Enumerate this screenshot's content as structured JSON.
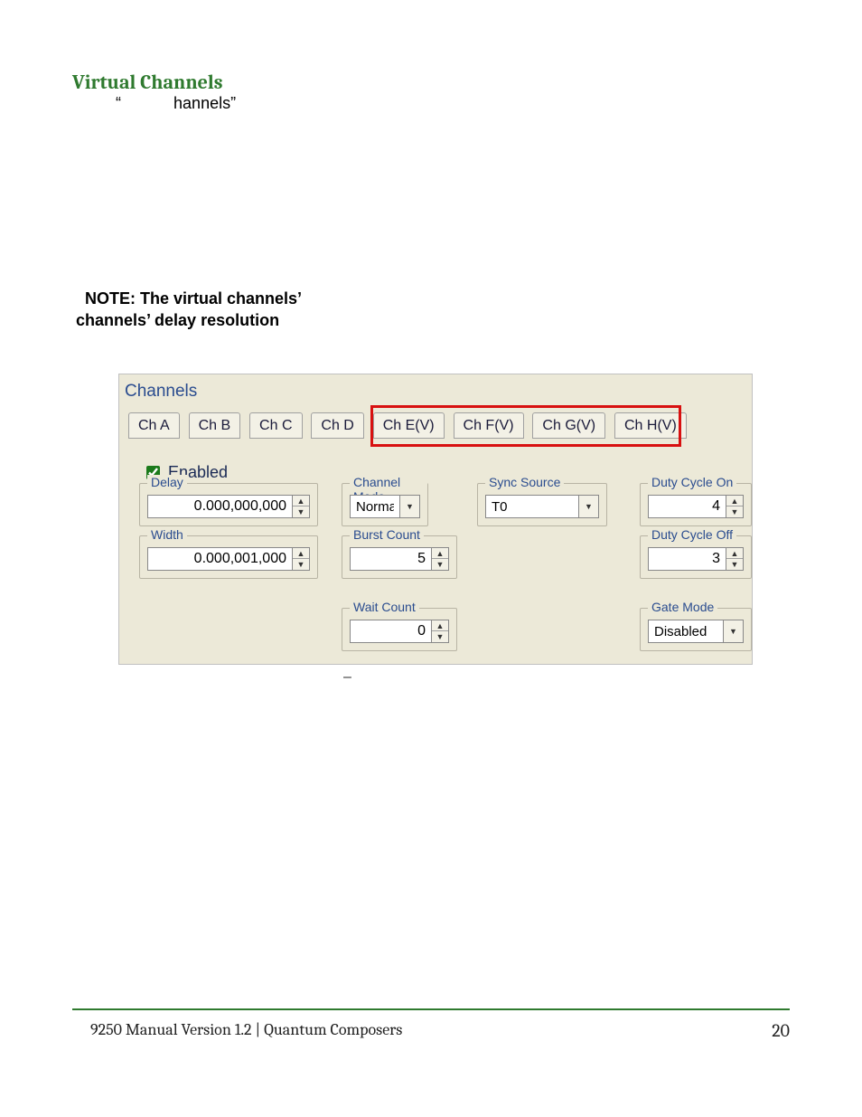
{
  "heading": "Virtual Channels",
  "subline_q1": "“",
  "subline_text": "hannels”",
  "note_line1_prefix": "NOTE: The virtual channels’",
  "note_line2": "channels’ delay resolution",
  "panel": {
    "title": "Channels",
    "tabs": [
      "Ch A",
      "Ch B",
      "Ch C",
      "Ch D",
      "Ch E(V)",
      "Ch F(V)",
      "Ch G(V)",
      "Ch H(V)"
    ],
    "enabled_label": "Enabled",
    "groups": {
      "delay": {
        "label": "Delay",
        "value": "0.000,000,000"
      },
      "width": {
        "label": "Width",
        "value": "0.000,001,000"
      },
      "chmode": {
        "label": "Channel Mode",
        "value": "Normal"
      },
      "burst": {
        "label": "Burst Count",
        "value": "5"
      },
      "wait": {
        "label": "Wait Count",
        "value": "0"
      },
      "sync": {
        "label": "Sync Source",
        "value": "T0"
      },
      "dcon": {
        "label": "Duty Cycle On",
        "value": "4"
      },
      "dcoff": {
        "label": "Duty Cycle Off",
        "value": "3"
      },
      "gate": {
        "label": "Gate Mode",
        "value": "Disabled"
      }
    }
  },
  "dash": "–",
  "footer": "9250 Manual Version 1.2  |  Quantum Composers",
  "page_number": "20"
}
